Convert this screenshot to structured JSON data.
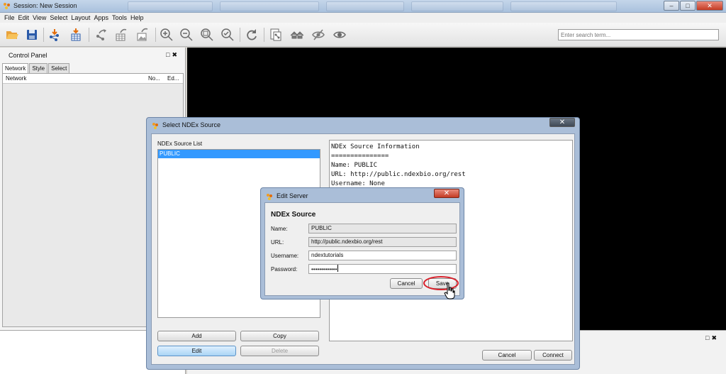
{
  "window": {
    "title": "Session: New Session",
    "controls": [
      "–",
      "□",
      "✕"
    ]
  },
  "menu": [
    "File",
    "Edit",
    "View",
    "Select",
    "Layout",
    "Apps",
    "Tools",
    "Help"
  ],
  "toolbar": {
    "icons": [
      "open-session-icon",
      "save-session-icon",
      "import-network-icon",
      "import-table-icon",
      "export-network-icon",
      "export-table-icon",
      "export-image-icon",
      "zoom-in-icon",
      "zoom-out-icon",
      "zoom-fit-icon",
      "zoom-selected-icon",
      "refresh-icon",
      "network-from-selection-icon",
      "home-icon",
      "hide-icon",
      "show-icon"
    ],
    "search_placeholder": "Enter search term..."
  },
  "control_panel": {
    "title": "Control Panel",
    "tabs": [
      "Network",
      "Style",
      "Select"
    ],
    "columns": [
      "Network",
      "No...",
      "Ed..."
    ]
  },
  "select_dialog": {
    "title": "Select NDEx Source",
    "list_label": "NDEx Source List",
    "sources": [
      "PUBLIC"
    ],
    "info_lines": [
      "NDEx Source Information",
      "===============",
      "Name: PUBLIC",
      "URL: http://public.ndexbio.org/rest",
      "Username: None"
    ],
    "buttons": {
      "add": "Add",
      "copy": "Copy",
      "edit": "Edit",
      "delete": "Delete",
      "cancel": "Cancel",
      "connect": "Connect"
    }
  },
  "edit_dialog": {
    "title": "Edit Server",
    "heading": "NDEx Source",
    "name_label": "Name:",
    "name_value": "PUBLIC",
    "url_label": "URL:",
    "url_value": "http://public.ndexbio.org/rest",
    "username_label": "Username:",
    "username_value": "ndextutorials",
    "password_label": "Password:",
    "password_value": "•••••••••••••",
    "cancel_label": "Cancel",
    "save_label": "Save"
  },
  "colors": {
    "selection": "#3399ff",
    "highlight_ring": "#d8202a",
    "dialog_frame": "#aabed8"
  }
}
